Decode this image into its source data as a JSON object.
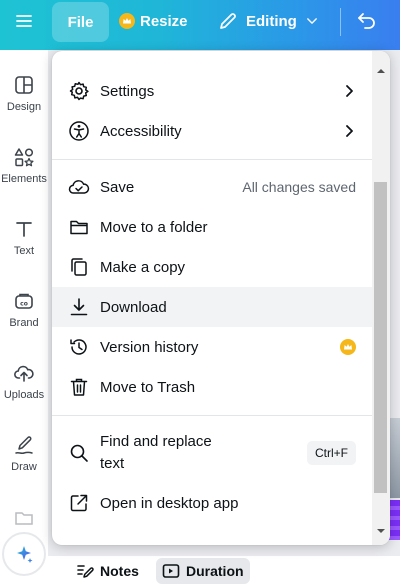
{
  "topbar": {
    "file_label": "File",
    "resize_label": "Resize",
    "editing_label": "Editing"
  },
  "sidebar": {
    "items": [
      {
        "label": "Design",
        "icon": "design-icon"
      },
      {
        "label": "Elements",
        "icon": "elements-icon"
      },
      {
        "label": "Text",
        "icon": "text-icon"
      },
      {
        "label": "Brand",
        "icon": "brand-icon"
      },
      {
        "label": "Uploads",
        "icon": "uploads-icon"
      },
      {
        "label": "Draw",
        "icon": "draw-icon"
      }
    ]
  },
  "menu": {
    "settings_label": "Settings",
    "accessibility_label": "Accessibility",
    "save_label": "Save",
    "save_status": "All changes saved",
    "move_folder_label": "Move to a folder",
    "make_copy_label": "Make a copy",
    "download_label": "Download",
    "version_history_label": "Version history",
    "trash_label": "Move to Trash",
    "find_replace_line1": "Find and replace",
    "find_replace_line2": "text",
    "find_replace_shortcut": "Ctrl+F",
    "open_desktop_label": "Open in desktop app"
  },
  "bottombar": {
    "notes_label": "Notes",
    "duration_label": "Duration"
  },
  "colors": {
    "gradient_start": "#1ec3d3",
    "gradient_end": "#3a7ef0",
    "crown": "#f5b719",
    "hover_row": "#f2f3f5"
  }
}
